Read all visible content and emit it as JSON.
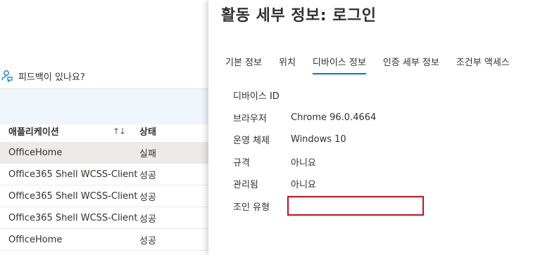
{
  "left": {
    "feedback_label": "피드백이 있나요?",
    "table": {
      "col_app": "애플리케이션",
      "col_sort_glyph": "↑↓",
      "col_status": "상태",
      "rows": [
        {
          "app": "OfficeHome",
          "status": "실패"
        },
        {
          "app": "Office365 Shell WCSS-Client",
          "status": "성공"
        },
        {
          "app": "Office365 Shell WCSS-Client",
          "status": "성공"
        },
        {
          "app": "Office365 Shell WCSS-Client",
          "status": "성공"
        },
        {
          "app": "OfficeHome",
          "status": "성공"
        }
      ]
    }
  },
  "panel": {
    "title": "활동 세부 정보: 로그인",
    "tabs": [
      {
        "label": "기본 정보"
      },
      {
        "label": "위치"
      },
      {
        "label": "디바이스 정보"
      },
      {
        "label": "인증 세부 정보"
      },
      {
        "label": "조건부 액세스"
      }
    ],
    "active_tab": "디바이스 정보",
    "fields": [
      {
        "label": "디바이스 ID",
        "value": ""
      },
      {
        "label": "브라우저",
        "value": "Chrome 96.0.4664"
      },
      {
        "label": "운영 체제",
        "value": "Windows 10"
      },
      {
        "label": "규격",
        "value": "아니요"
      },
      {
        "label": "관리됨",
        "value": "아니요"
      },
      {
        "label": "조인 유형",
        "value": ""
      }
    ]
  },
  "colors": {
    "accent": "#0078d4",
    "highlight_box": "#c50f1f",
    "selected_row": "#edebe9",
    "filter_bar": "#eff6fc"
  }
}
